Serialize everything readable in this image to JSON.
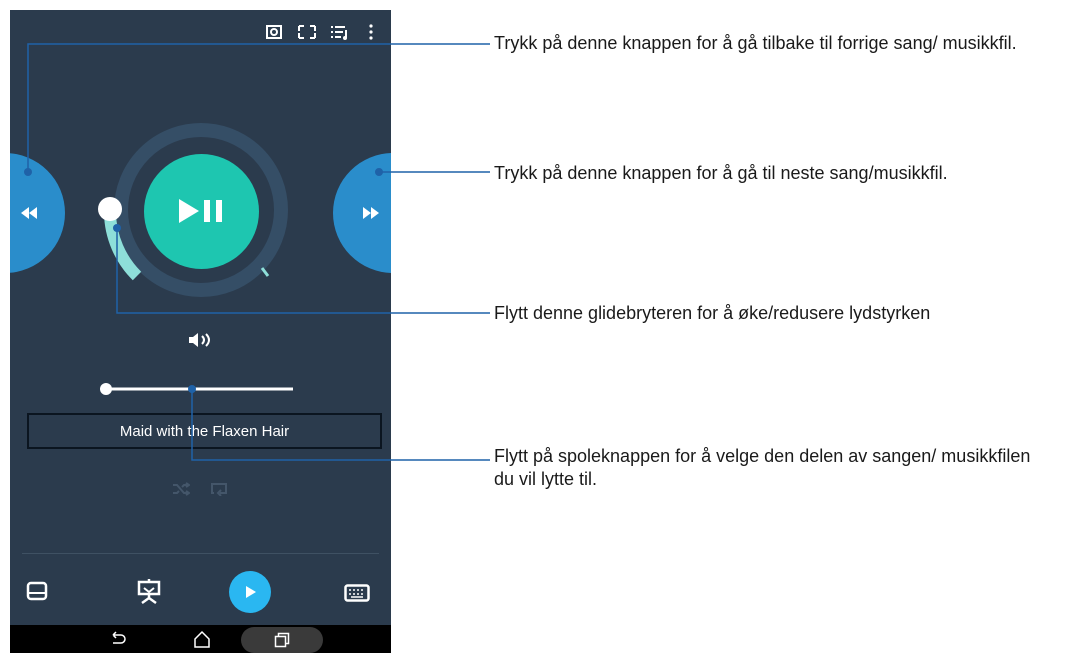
{
  "player": {
    "track_title": "Maid with the Flaxen Hair"
  },
  "icons": {
    "top_bar": [
      "cast-icon",
      "fullscreen-icon",
      "playlist-icon",
      "more-options-icon"
    ],
    "prev": "rewind-icon",
    "next": "fast-forward-icon",
    "play_pause": "play-pause-icon",
    "volume": "volume-icon",
    "shuffle": "shuffle-icon",
    "repeat": "repeat-icon",
    "bottom_bar": [
      "touchpad-icon",
      "presentation-icon",
      "play-icon",
      "keyboard-icon"
    ],
    "nav": [
      "back-icon",
      "home-icon",
      "recents-icon"
    ]
  },
  "callouts": {
    "prev": "Trykk på denne knappen for å gå tilbake til forrige sang/ musikkfil.",
    "next": "Trykk på denne knappen for å gå til neste sang/musikkfil.",
    "volume": "Flytt denne glidebryteren for å øke/redusere lydstyrken",
    "seek": "Flytt på spoleknappen for å velge den delen av sangen/ musikkfilen du vil lytte til."
  },
  "colors": {
    "background": "#2b3b4d",
    "accent_teal": "#1ec6b0",
    "accent_blue": "#2a8dcb",
    "play_blue": "#2ab7f1",
    "callout_line": "#1f62a8"
  },
  "seek_progress": 0.47
}
